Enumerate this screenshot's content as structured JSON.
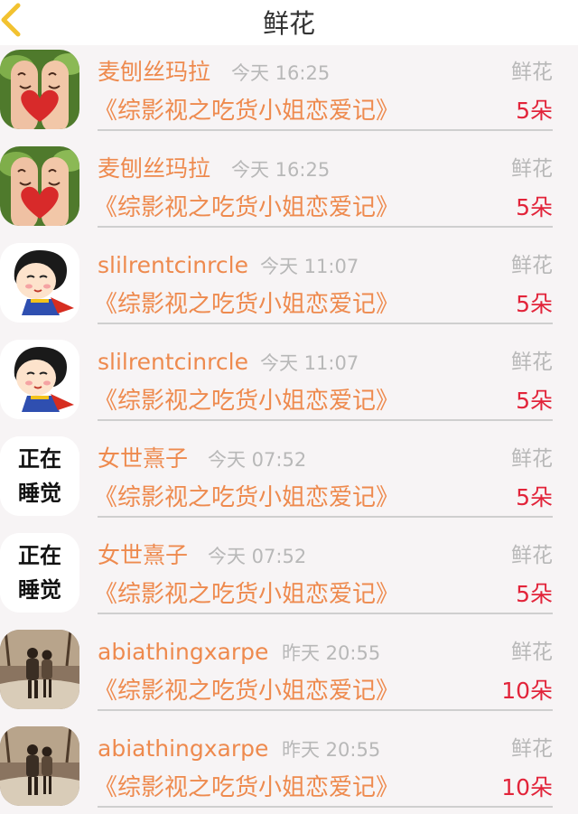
{
  "navbar": {
    "title": "鲜花",
    "back_icon": "chevron-left-icon",
    "accent_color": "#f2c230"
  },
  "list": {
    "items": [
      {
        "avatar": "finger-couple-photo",
        "user": "麦刨丝玛拉",
        "time": "今天 16:25",
        "type": "鲜花",
        "book": "《综影视之吃货小姐恋爱记》",
        "count": "5朵"
      },
      {
        "avatar": "finger-couple-photo",
        "user": "麦刨丝玛拉",
        "time": "今天 16:25",
        "type": "鲜花",
        "book": "《综影视之吃货小姐恋爱记》",
        "count": "5朵"
      },
      {
        "avatar": "cartoon-boy-cape",
        "user": "slilrentcinrcle",
        "time": "今天 11:07",
        "type": "鲜花",
        "book": "《综影视之吃货小姐恋爱记》",
        "count": "5朵"
      },
      {
        "avatar": "cartoon-boy-cape",
        "user": "slilrentcinrcle",
        "time": "今天 11:07",
        "type": "鲜花",
        "book": "《综影视之吃货小姐恋爱记》",
        "count": "5朵"
      },
      {
        "avatar": "text",
        "avatar_text": [
          "正在",
          "睡觉"
        ],
        "user": "女世熹子",
        "time": "今天 07:52",
        "type": "鲜花",
        "book": "《综影视之吃货小姐恋爱记》",
        "count": "5朵"
      },
      {
        "avatar": "text",
        "avatar_text": [
          "正在",
          "睡觉"
        ],
        "user": "女世熹子",
        "time": "今天 07:52",
        "type": "鲜花",
        "book": "《综影视之吃货小姐恋爱记》",
        "count": "5朵"
      },
      {
        "avatar": "couple-walking-photo",
        "user": "abiathingxarpe",
        "time": "昨天 20:55",
        "type": "鲜花",
        "book": "《综影视之吃货小姐恋爱记》",
        "count": "10朵"
      },
      {
        "avatar": "couple-walking-photo",
        "user": "abiathingxarpe",
        "time": "昨天 20:55",
        "type": "鲜花",
        "book": "《综影视之吃货小姐恋爱记》",
        "count": "10朵"
      }
    ]
  }
}
